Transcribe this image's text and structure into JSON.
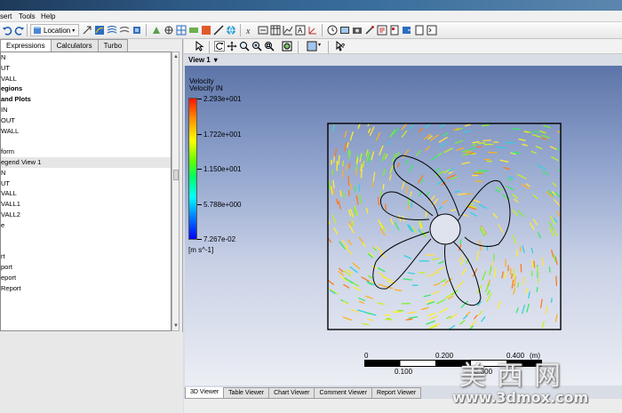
{
  "menu": {
    "items": [
      "sert",
      "Tools",
      "Help"
    ]
  },
  "toolbar": {
    "location_label": "Location"
  },
  "left_panel": {
    "tabs": [
      "Expressions",
      "Calculators",
      "Turbo"
    ],
    "tree": [
      {
        "label": "N",
        "bold": false
      },
      {
        "label": "UT",
        "bold": false
      },
      {
        "label": "VALL",
        "bold": false
      },
      {
        "label": "egions",
        "bold": true
      },
      {
        "label": "and Plots",
        "bold": true
      },
      {
        "label": "IN",
        "bold": false
      },
      {
        "label": "OUT",
        "bold": false
      },
      {
        "label": "WALL",
        "bold": false
      },
      {
        "label": "",
        "bold": false
      },
      {
        "label": "form",
        "bold": false
      },
      {
        "label": "egend View 1",
        "bold": false
      },
      {
        "label": "N",
        "bold": false
      },
      {
        "label": "UT",
        "bold": false
      },
      {
        "label": "VALL",
        "bold": false
      },
      {
        "label": "VALL1",
        "bold": false
      },
      {
        "label": "VALL2",
        "bold": false
      },
      {
        "label": "e",
        "bold": false
      },
      {
        "label": "",
        "bold": false
      },
      {
        "label": "",
        "bold": false
      },
      {
        "label": "rt",
        "bold": false
      },
      {
        "label": "port",
        "bold": false
      },
      {
        "label": "eport",
        "bold": false
      },
      {
        "label": "Report",
        "bold": false
      }
    ]
  },
  "viewer": {
    "view_name": "View 1",
    "dropdown_glyph": "▾"
  },
  "legend": {
    "title": "Velocity",
    "subtitle": "Velocity IN",
    "values": [
      "2.293e+001",
      "1.722e+001",
      "1.150e+001",
      "5.788e+000",
      "7.267e-02"
    ],
    "unit": "[m s^-1]",
    "colors": {
      "max": "#ff1400",
      "mid": "#66ff00",
      "min": "#0000ff"
    }
  },
  "scale_bar": {
    "top_labels": [
      "0",
      "0.200",
      "0.400",
      "(m)"
    ],
    "bottom_labels": [
      "0.100",
      "0.300"
    ]
  },
  "bottom_tabs": [
    "3D Viewer",
    "Table Viewer",
    "Chart Viewer",
    "Comment Viewer",
    "Report Viewer"
  ],
  "watermark": {
    "chinese": "美西网",
    "url": "www.3dmox.com"
  },
  "icons": {
    "undo": "undo-icon",
    "redo": "redo-icon",
    "location": "location-icon",
    "select": "select-cursor-icon",
    "rotate": "rotate-icon",
    "pan": "pan-icon",
    "zoom": "zoom-icon",
    "fit": "fit-view-icon",
    "help": "help-icon"
  }
}
